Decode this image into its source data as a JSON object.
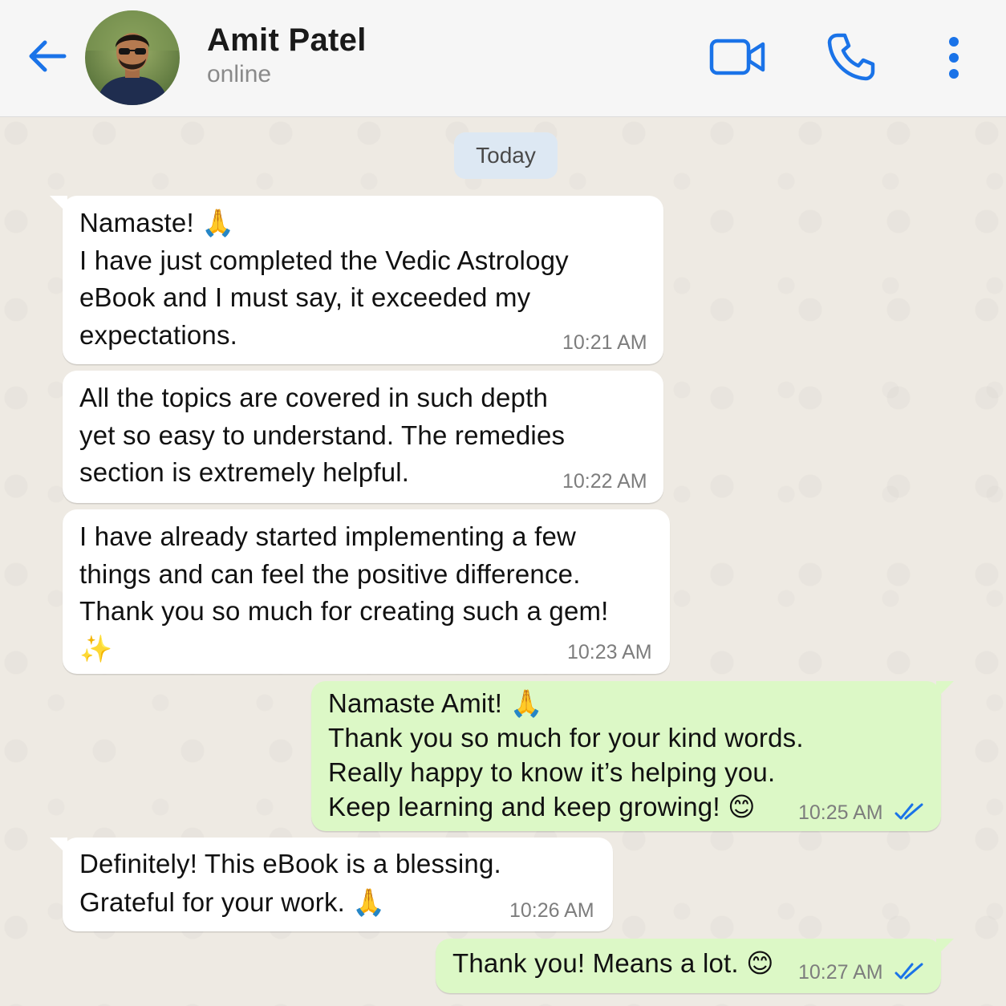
{
  "header": {
    "contact_name": "Amit Patel",
    "contact_status": "online",
    "back_icon": "arrow-left-icon",
    "video_icon": "video-camera-icon",
    "call_icon": "phone-icon",
    "menu_icon": "more-vertical-icon",
    "accent_color": "#1a73e8"
  },
  "chat": {
    "date_label": "Today",
    "messages": [
      {
        "direction": "incoming",
        "text": "Namaste! 🙏\nI have just completed the Vedic Astrology\neBook and I must say, it exceeded my\nexpectations.",
        "time": "10:21 AM"
      },
      {
        "direction": "incoming",
        "text": "All the topics are covered in such depth\nyet so easy to understand. The remedies\nsection is extremely helpful.",
        "time": "10:22 AM"
      },
      {
        "direction": "incoming",
        "text": "I have already started implementing a few\nthings and can feel the positive difference.\nThank you so much for creating such a gem!\n✨",
        "time": "10:23 AM"
      },
      {
        "direction": "outgoing",
        "text": "Namaste Amit! 🙏\nThank you so much for your kind words.\nReally happy to know it’s helping you.\nKeep learning and keep growing! 😊",
        "time": "10:25 AM",
        "status": "read"
      },
      {
        "direction": "incoming",
        "text": "Definitely! This eBook is a blessing.\nGrateful for your work. 🙏",
        "time": "10:26 AM"
      },
      {
        "direction": "outgoing",
        "text": "Thank you! Means a lot. 😊",
        "time": "10:27 AM",
        "status": "read"
      }
    ]
  },
  "colors": {
    "incoming_bubble": "#ffffff",
    "outgoing_bubble": "#dcf8c6",
    "read_ticks": "#1a73e8",
    "date_chip": "#dde8f3"
  }
}
